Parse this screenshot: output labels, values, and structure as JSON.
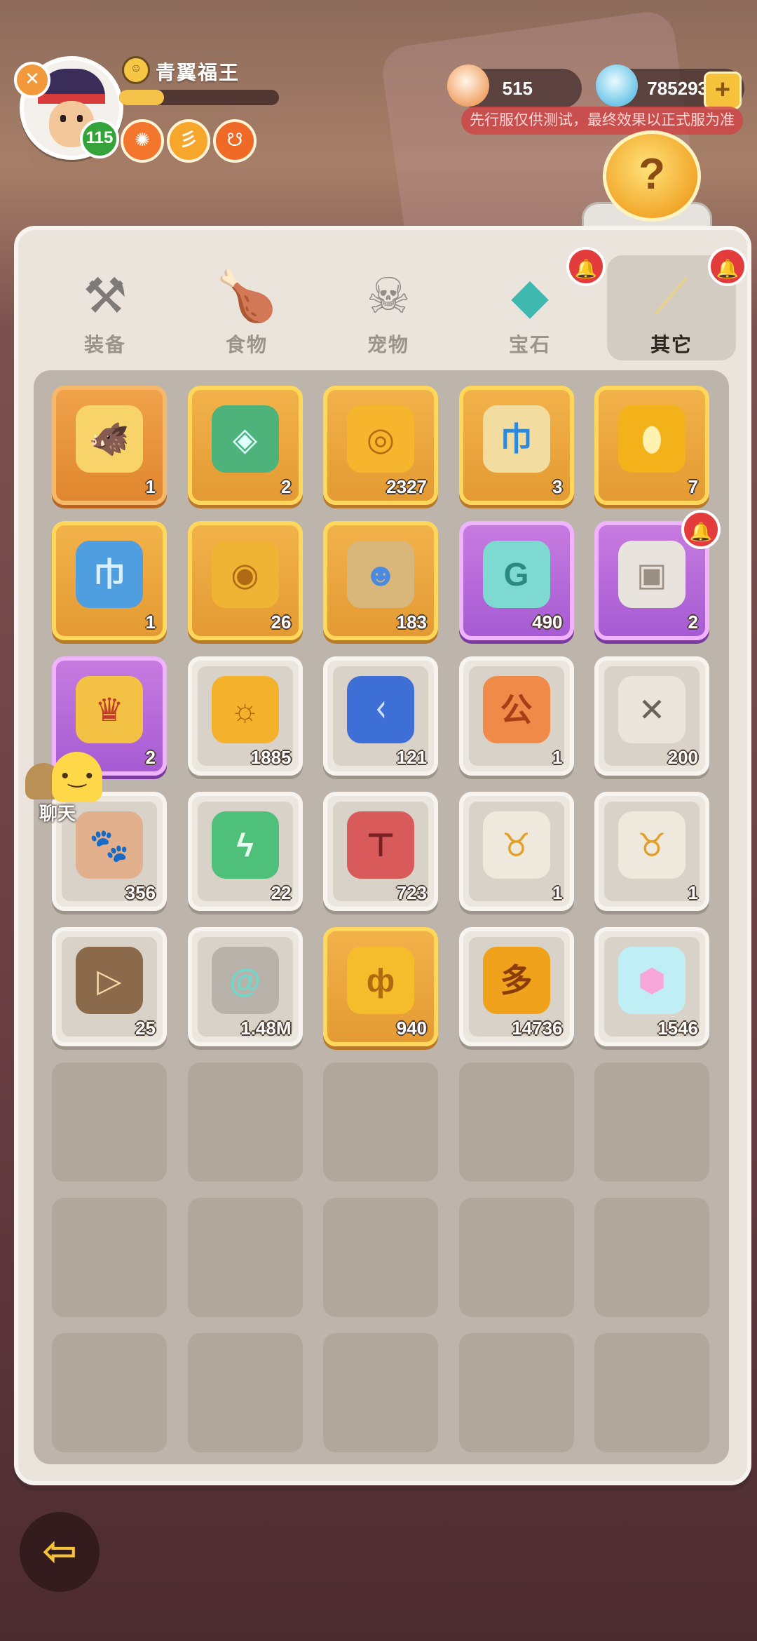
{
  "header": {
    "player_name": "青翼福王",
    "level": "115",
    "exp_fraction": 0.28,
    "currencies": [
      {
        "icon": "shell-icon",
        "value": "515"
      },
      {
        "icon": "diamond-icon",
        "value": "785293"
      }
    ],
    "test_notice": "先行服仅供测试，最终效果以正式服为准"
  },
  "tabs": [
    {
      "label": "装备",
      "icon": "equipment-icon",
      "active": false,
      "badge": false
    },
    {
      "label": "食物",
      "icon": "food-icon",
      "active": false,
      "badge": false
    },
    {
      "label": "宠物",
      "icon": "pet-icon",
      "active": false,
      "badge": false
    },
    {
      "label": "宝石",
      "icon": "gem-icon",
      "active": false,
      "badge": true
    },
    {
      "label": "其它",
      "icon": "bone-icon",
      "active": true,
      "badge": true
    }
  ],
  "items": [
    {
      "icon": "boar-crystal-icon",
      "rarity": "orange",
      "count": "1"
    },
    {
      "icon": "crystal-bag-icon",
      "rarity": "gold",
      "count": "2"
    },
    {
      "icon": "spiral-coin-icon",
      "rarity": "gold",
      "count": "2327"
    },
    {
      "icon": "blue-scroll-icon",
      "rarity": "gold",
      "count": "3"
    },
    {
      "icon": "amber-egg-icon",
      "rarity": "gold",
      "count": "7"
    },
    {
      "icon": "blue-ticket-icon",
      "rarity": "gold",
      "count": "1"
    },
    {
      "icon": "shell-coin-icon",
      "rarity": "gold",
      "count": "26"
    },
    {
      "icon": "idol-statue-icon",
      "rarity": "gold",
      "count": "183"
    },
    {
      "icon": "teal-ticket-icon",
      "rarity": "purple",
      "count": "490"
    },
    {
      "icon": "white-chest-icon",
      "rarity": "purple",
      "count": "2",
      "badge": true
    },
    {
      "icon": "horned-chest-icon",
      "rarity": "purple",
      "count": "2"
    },
    {
      "icon": "sun-coin-icon",
      "rarity": "grey",
      "count": "1885"
    },
    {
      "icon": "blue-rune-stone-icon",
      "rarity": "grey",
      "count": "121"
    },
    {
      "icon": "orange-scroll-icon",
      "rarity": "grey",
      "count": "1"
    },
    {
      "icon": "stone-dice-icon",
      "rarity": "grey",
      "count": "200"
    },
    {
      "icon": "paw-ticket-icon",
      "rarity": "grey",
      "count": "356"
    },
    {
      "icon": "green-ticket-icon",
      "rarity": "grey",
      "count": "22"
    },
    {
      "icon": "red-hammer-ticket-icon",
      "rarity": "grey",
      "count": "723"
    },
    {
      "icon": "horn-card-icon",
      "rarity": "grey",
      "count": "1"
    },
    {
      "icon": "horn-card-icon",
      "rarity": "grey",
      "count": "1"
    },
    {
      "icon": "play-ticket-icon",
      "rarity": "grey",
      "count": "25"
    },
    {
      "icon": "spiral-stone-icon",
      "rarity": "grey",
      "count": "1.48M"
    },
    {
      "icon": "gold-coin-icon",
      "rarity": "gold",
      "count": "940"
    },
    {
      "icon": "star-coin-icon",
      "rarity": "grey",
      "count": "14736"
    },
    {
      "icon": "rainbow-crystal-icon",
      "rarity": "grey",
      "count": "1546"
    }
  ],
  "empty_slots": 15,
  "chat": {
    "label": "聊天"
  },
  "colors": {
    "gold": "#f2b24a",
    "purple": "#b56cdb",
    "orange": "#e88e37",
    "grey": "#ebe6de",
    "badge": "#e33c3c"
  }
}
